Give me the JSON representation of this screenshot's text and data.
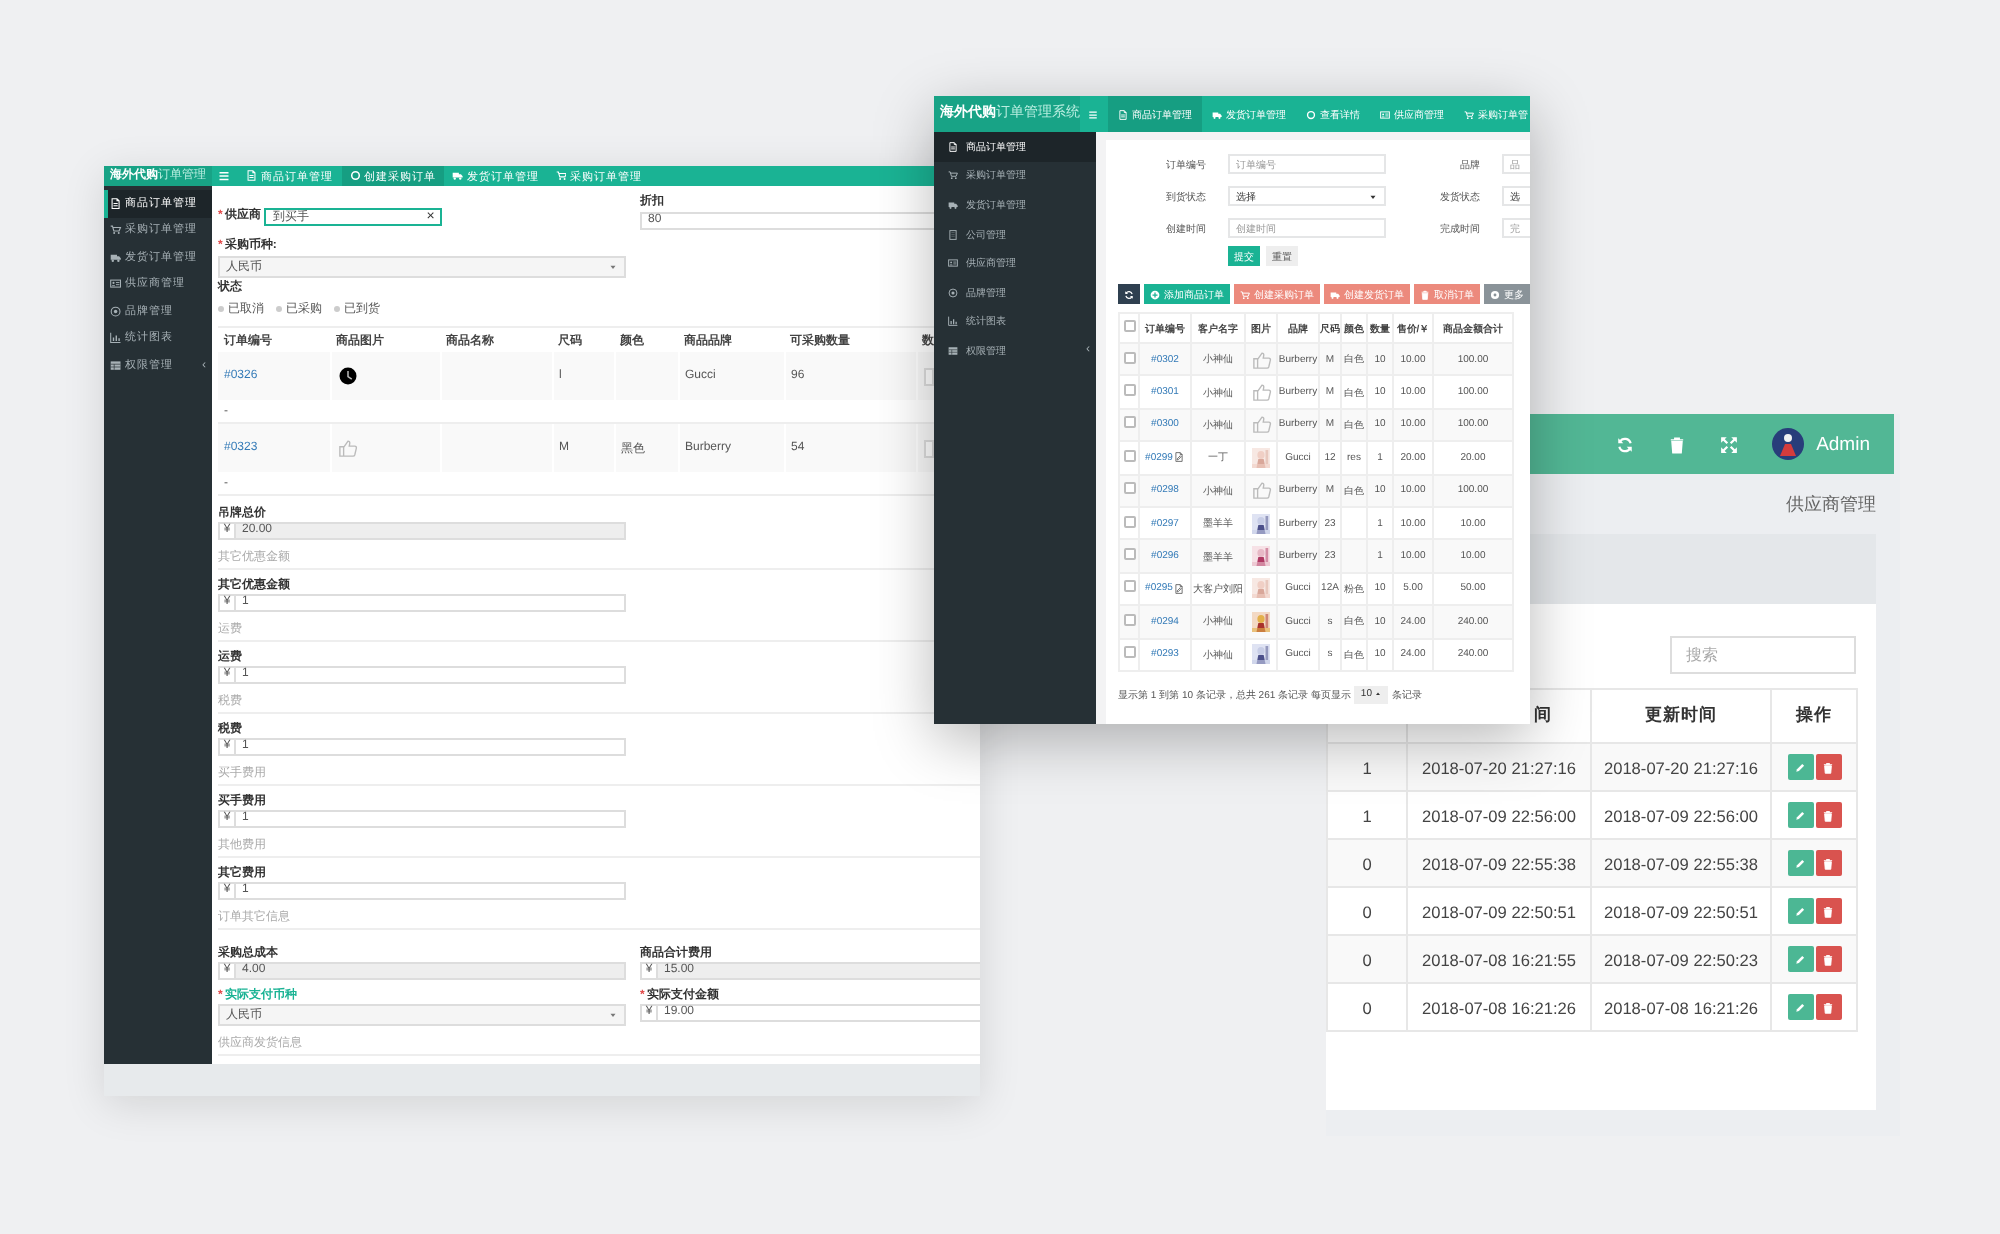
{
  "order_form_window": {
    "brand": "海外代购",
    "brand_sub": "订单管理",
    "required_mark": "*",
    "nav": [
      {
        "label": "商品订单管理",
        "selected": false
      },
      {
        "label": "创建采购订单",
        "selected": true
      },
      {
        "label": "发货订单管理",
        "selected": false
      },
      {
        "label": "采购订单管理",
        "selected": false
      }
    ],
    "sidebar": [
      {
        "label": "商品订单管理",
        "selected": true
      },
      {
        "label": "采购订单管理",
        "selected": false
      },
      {
        "label": "发货订单管理",
        "selected": false
      },
      {
        "label": "供应商管理",
        "selected": false
      },
      {
        "label": "品牌管理",
        "selected": false
      },
      {
        "label": "统计图表",
        "selected": false
      },
      {
        "label": "权限管理",
        "selected": false
      }
    ],
    "collapse": "‹",
    "supplier": {
      "label": "供应商",
      "required": true,
      "value": "到买手",
      "clear": "×"
    },
    "discount": {
      "label": "折扣",
      "value": "80"
    },
    "currency": {
      "label": "采购币种:",
      "required": true,
      "value": "人民币"
    },
    "status": {
      "label": "状态",
      "options": [
        {
          "label": "已取消",
          "selected": false
        },
        {
          "label": "已采购",
          "selected": false
        },
        {
          "label": "已到货",
          "selected": false
        }
      ]
    },
    "table": {
      "columns": [
        "订单编号",
        "商品图片",
        "商品名称",
        "尺码",
        "颜色",
        "商品品牌",
        "可采购数量",
        "数"
      ],
      "rows": [
        {
          "order_no": "#0326",
          "image_loading": true,
          "size": "l",
          "brand": "Gucci",
          "available": "96",
          "detail": "-"
        },
        {
          "order_no": "#0323",
          "image_loading": false,
          "size": "M",
          "colour_name": "黑色",
          "brand": "Burberry",
          "available": "54",
          "detail": "-"
        }
      ]
    },
    "fields": [
      {
        "kind": "money",
        "label": "吊牌总价",
        "symbol": "¥",
        "value": "20.00",
        "disabled": true
      },
      {
        "kind": "hint",
        "label": "其它优惠金额"
      },
      {
        "kind": "money",
        "label": "其它优惠金额",
        "symbol": "¥",
        "value": "1",
        "disabled": false
      },
      {
        "kind": "hint",
        "label": "运费"
      },
      {
        "kind": "money",
        "label": "运费",
        "symbol": "¥",
        "value": "1",
        "disabled": false
      },
      {
        "kind": "hint",
        "label": "税费"
      },
      {
        "kind": "money",
        "label": "税费",
        "symbol": "¥",
        "value": "1",
        "disabled": false
      },
      {
        "kind": "hint",
        "label": "买手费用"
      },
      {
        "kind": "money",
        "label": "买手费用",
        "symbol": "¥",
        "value": "1",
        "disabled": false
      },
      {
        "kind": "hint",
        "label": "其他费用"
      },
      {
        "kind": "money",
        "label": "其它费用",
        "symbol": "¥",
        "value": "1",
        "disabled": false
      },
      {
        "kind": "hint",
        "label": "订单其它信息"
      }
    ],
    "pairs": [
      [
        {
          "kind": "money",
          "label": "采购总成本",
          "symbol": "¥",
          "value": "4.00",
          "disabled": true,
          "required": false,
          "highlighted": false
        },
        {
          "kind": "money",
          "label": "商品合计费用",
          "symbol": "¥",
          "value": "15.00",
          "disabled": true,
          "required": false,
          "highlighted": false
        }
      ],
      [
        {
          "kind": "select",
          "label": "实际支付币种",
          "value": "人民币",
          "required": true,
          "highlighted": true
        },
        {
          "kind": "money",
          "label": "实际支付金额",
          "symbol": "¥",
          "value": "19.00",
          "disabled": false,
          "required": true,
          "highlighted": false
        }
      ]
    ],
    "trailing_hint": "供应商发货信息"
  },
  "order_list_window": {
    "brand": "海外代购",
    "brand_sub": "订单管理系统",
    "nav": [
      {
        "label": "商品订单管理",
        "selected": true
      },
      {
        "label": "发货订单管理",
        "selected": false
      },
      {
        "label": "查看详情",
        "selected": false
      },
      {
        "label": "供应商管理",
        "selected": false
      },
      {
        "label": "采购订单管",
        "selected": false
      }
    ],
    "sidebar": [
      {
        "label": "商品订单管理",
        "selected": true
      },
      {
        "label": "采购订单管理",
        "selected": false
      },
      {
        "label": "发货订单管理",
        "selected": false
      },
      {
        "label": "公司管理",
        "selected": false
      },
      {
        "label": "供应商管理",
        "selected": false
      },
      {
        "label": "品牌管理",
        "selected": false
      },
      {
        "label": "统计图表",
        "selected": false
      },
      {
        "label": "权限管理",
        "selected": false
      }
    ],
    "collapse": "‹",
    "filters": [
      {
        "label": "订单编号",
        "kind": "text",
        "placeholder": "订单编号"
      },
      {
        "label": "品牌",
        "kind": "text",
        "placeholder": "品"
      },
      {
        "label": "到货状态",
        "kind": "select",
        "value": "选择"
      },
      {
        "label": "发货状态",
        "kind": "select",
        "value": "选"
      },
      {
        "label": "创建时间",
        "kind": "text",
        "placeholder": "创建时间"
      },
      {
        "label": "完成时间",
        "kind": "text",
        "placeholder": "完"
      }
    ],
    "submit": "提交",
    "reset": "重置",
    "toolbar": [
      {
        "kind": "refresh"
      },
      {
        "kind": "primary",
        "label": "添加商品订单"
      },
      {
        "kind": "danger",
        "label": "创建采购订单"
      },
      {
        "kind": "danger",
        "label": "创建发货订单"
      },
      {
        "kind": "danger",
        "label": "取消订单"
      },
      {
        "kind": "default",
        "label": "更多"
      }
    ],
    "all_checked": false,
    "columns": [
      "订单编号",
      "客户名字",
      "图片",
      "品牌",
      "尺码",
      "颜色",
      "数量",
      "售价/￥",
      "商品金额合计"
    ],
    "rows": [
      {
        "checked": false,
        "order_no": "#0302",
        "note": false,
        "customer": "小神仙",
        "has_photo": false,
        "brand": "Burberry",
        "size": "M",
        "colour_name": "白色",
        "qty": "10",
        "price": "10.00",
        "total": "100.00"
      },
      {
        "checked": false,
        "order_no": "#0301",
        "note": false,
        "customer": "小神仙",
        "has_photo": false,
        "brand": "Burberry",
        "size": "M",
        "colour_name": "白色",
        "qty": "10",
        "price": "10.00",
        "total": "100.00"
      },
      {
        "checked": false,
        "order_no": "#0300",
        "note": false,
        "customer": "小神仙",
        "has_photo": false,
        "brand": "Burberry",
        "size": "M",
        "colour_name": "白色",
        "qty": "10",
        "price": "10.00",
        "total": "100.00"
      },
      {
        "checked": false,
        "order_no": "#0299",
        "note": true,
        "customer": "一丁",
        "has_photo": true,
        "brand": "Gucci",
        "size": "12",
        "colour_name": "res",
        "qty": "1",
        "price": "20.00",
        "total": "20.00"
      },
      {
        "checked": false,
        "order_no": "#0298",
        "note": false,
        "customer": "小神仙",
        "has_photo": false,
        "brand": "Burberry",
        "size": "M",
        "colour_name": "白色",
        "qty": "10",
        "price": "10.00",
        "total": "100.00"
      },
      {
        "checked": false,
        "order_no": "#0297",
        "note": false,
        "customer": "墨羊羊",
        "has_photo": true,
        "brand": "Burberry",
        "size": "23",
        "qty": "1",
        "price": "10.00",
        "total": "10.00"
      },
      {
        "checked": false,
        "order_no": "#0296",
        "note": false,
        "customer": "墨羊羊",
        "has_photo": true,
        "brand": "Burberry",
        "size": "23",
        "qty": "1",
        "price": "10.00",
        "total": "10.00"
      },
      {
        "checked": false,
        "order_no": "#0295",
        "note": true,
        "customer": "大客户刘阳",
        "has_photo": true,
        "brand": "Gucci",
        "size": "12A",
        "colour_name": "粉色",
        "qty": "10",
        "price": "5.00",
        "total": "50.00"
      },
      {
        "checked": false,
        "order_no": "#0294",
        "note": false,
        "customer": "小神仙",
        "has_photo": true,
        "brand": "Gucci",
        "size": "s",
        "colour_name": "白色",
        "qty": "10",
        "price": "24.00",
        "total": "240.00"
      },
      {
        "checked": false,
        "order_no": "#0293",
        "note": false,
        "customer": "小神仙",
        "has_photo": true,
        "brand": "Gucci",
        "size": "s",
        "colour_name": "白色",
        "qty": "10",
        "price": "24.00",
        "total": "240.00"
      }
    ],
    "footer": {
      "summary": "显示第 1 到第 10 条记录，总共 261 条记录 每页显示",
      "page_size": "10",
      "suffix": "条记录"
    }
  },
  "supplier_window": {
    "user": "Admin",
    "breadcrumb": "供应商管理",
    "search_placeholder": "搜索",
    "columns": [
      "间",
      "更新时间",
      "操作"
    ],
    "rows": [
      {
        "count": "1",
        "created": "2018-07-20 21:27:16",
        "updated": "2018-07-20 21:27:16"
      },
      {
        "count": "1",
        "created": "2018-07-09 22:56:00",
        "updated": "2018-07-09 22:56:00"
      },
      {
        "count": "0",
        "created": "2018-07-09 22:55:38",
        "updated": "2018-07-09 22:55:38"
      },
      {
        "count": "0",
        "created": "2018-07-09 22:50:51",
        "updated": "2018-07-09 22:50:51"
      },
      {
        "count": "0",
        "created": "2018-07-08 16:21:55",
        "updated": "2018-07-09 22:50:23"
      },
      {
        "count": "0",
        "created": "2018-07-08 16:21:26",
        "updated": "2018-07-08 16:21:26"
      }
    ]
  }
}
